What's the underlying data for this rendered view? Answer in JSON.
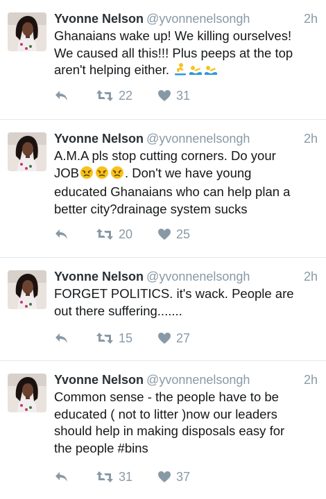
{
  "colors": {
    "action_gray": "#8899a6",
    "divider": "#e1e8ed",
    "emoji_yellow": "#f8c21c",
    "emoji_blue": "#2b9ad8"
  },
  "icons": {
    "reply": "reply-icon",
    "retweet": "retweet-icon",
    "like": "heart-icon"
  },
  "tweets": [
    {
      "name": "Yvonne Nelson",
      "handle": "@yvonnenelsongh",
      "time": "2h",
      "lines": [
        "Ghanaians wake up! We killing ourselves!",
        "We caused all this!!! Plus peeps at the top",
        "aren't helping either."
      ],
      "emojis": [
        "person-surfing-emoji",
        "person-swimming-emoji",
        "person-swimming-emoji"
      ],
      "retweets": "22",
      "likes": "31"
    },
    {
      "name": "Yvonne Nelson",
      "handle": "@yvonnenelsongh",
      "time": "2h",
      "lines": [
        "A.M.A pls stop cutting corners. Do your",
        "JOB",
        ". Don't we have young",
        "educated Ghanaians who can help plan a",
        "better city?drainage system sucks"
      ],
      "emojis": [
        "angry-face-emoji",
        "angry-face-emoji",
        "angry-face-emoji"
      ],
      "retweets": "20",
      "likes": "25"
    },
    {
      "name": "Yvonne Nelson",
      "handle": "@yvonnenelsongh",
      "time": "2h",
      "lines": [
        "FORGET POLITICS. it's wack. People are",
        "out there suffering......."
      ],
      "retweets": "15",
      "likes": "27"
    },
    {
      "name": "Yvonne Nelson",
      "handle": "@yvonnenelsongh",
      "time": "2h",
      "lines": [
        "Common sense - the people have to be",
        "educated ( not to litter )now our leaders",
        "should help in making disposals easy for",
        "the people #bins"
      ],
      "retweets": "31",
      "likes": "37"
    }
  ]
}
